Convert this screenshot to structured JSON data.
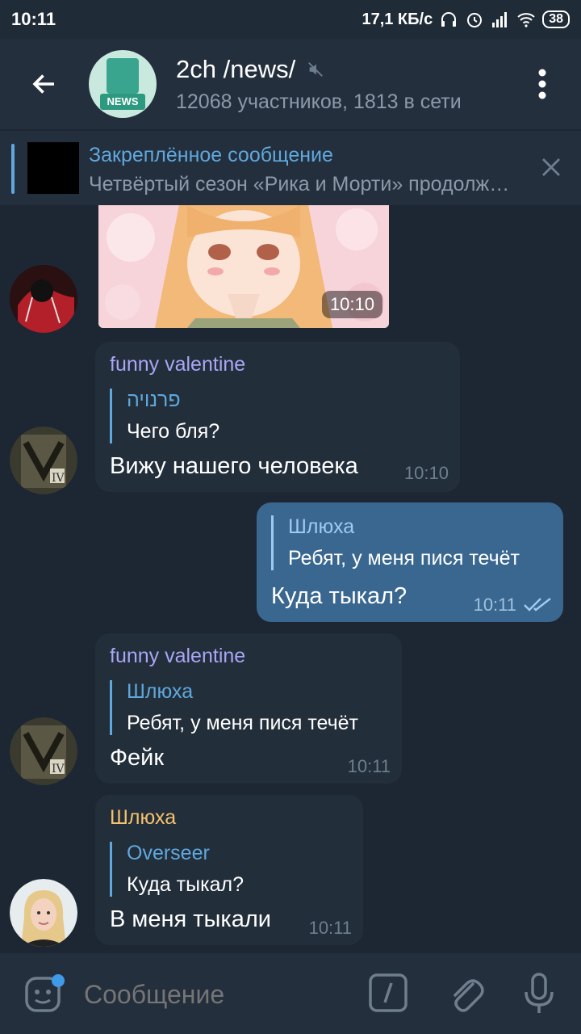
{
  "status": {
    "time": "10:11",
    "speed": "17,1 КБ/с",
    "battery": "38"
  },
  "header": {
    "title": "2ch /news/",
    "subtitle": "12068 участников, 1813 в сети",
    "avatar_text": "NEWS"
  },
  "pinned": {
    "title": "Закреплённое сообщение",
    "text": "Четвёртый сезон «Рика и Морти» продолжится"
  },
  "messages": {
    "m0": {
      "time": "10:10"
    },
    "m1": {
      "sender": "funny valentine",
      "reply_name": "פרנויה",
      "reply_text": "Чего бля?",
      "text": "Вижу нашего человека",
      "time": "10:10"
    },
    "m2": {
      "reply_name": "Шлюха",
      "reply_text": "Ребят, у меня пися течёт",
      "text": "Куда тыкал?",
      "time": "10:11"
    },
    "m3": {
      "sender": "funny valentine",
      "reply_name": "Шлюха",
      "reply_text": "Ребят, у меня пися течёт",
      "text": "Фейк",
      "time": "10:11"
    },
    "m4": {
      "sender": "Шлюха",
      "reply_name": "Overseer",
      "reply_text": "Куда тыкал?",
      "text": "В меня тыкали",
      "time": "10:11"
    }
  },
  "input": {
    "placeholder": "Сообщение"
  },
  "colors": {
    "background": "#1c2733",
    "header": "#242f3d",
    "bubble_in": "#222e3a",
    "bubble_out": "#3a6790",
    "accent": "#5fa8dd",
    "sender_purple": "#a9a6f5",
    "sender_orange": "#f5c16c"
  },
  "icons": [
    "back-arrow-icon",
    "mute-icon",
    "more-vert-icon",
    "close-icon",
    "sticker-icon",
    "command-icon",
    "attach-icon",
    "mic-icon",
    "double-check-icon"
  ]
}
